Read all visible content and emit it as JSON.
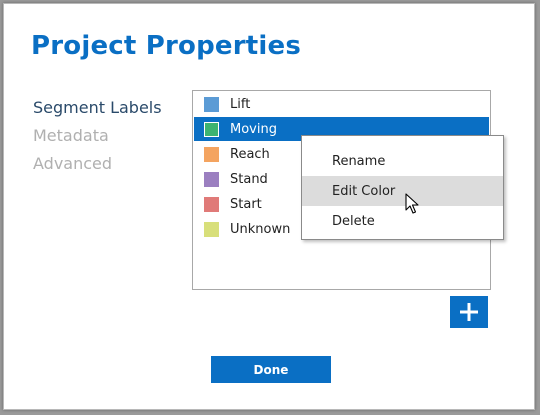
{
  "dialog": {
    "title": "Project Properties"
  },
  "nav": {
    "items": [
      {
        "label": "Segment Labels",
        "active": true
      },
      {
        "label": "Metadata",
        "active": false
      },
      {
        "label": "Advanced",
        "active": false
      }
    ]
  },
  "segments": [
    {
      "label": "Lift",
      "color": "#5b9bd5",
      "selected": false
    },
    {
      "label": "Moving",
      "color": "#3cb371",
      "selected": true
    },
    {
      "label": "Reach",
      "color": "#f4a460",
      "selected": false
    },
    {
      "label": "Stand",
      "color": "#9b7fc0",
      "selected": false
    },
    {
      "label": "Start",
      "color": "#e07a78",
      "selected": false
    },
    {
      "label": "Unknown",
      "color": "#d8df7a",
      "selected": false
    }
  ],
  "context_menu": {
    "items": [
      {
        "label": "Rename",
        "hover": false
      },
      {
        "label": "Edit Color",
        "hover": true
      },
      {
        "label": "Delete",
        "hover": false
      }
    ]
  },
  "buttons": {
    "add_icon": "plus-icon",
    "done_label": "Done"
  },
  "colors": {
    "accent": "#0a6fc4",
    "nav_active": "#2a4a6a",
    "nav_inactive": "#b0b0b0",
    "menu_hover": "#dcdcdc"
  }
}
